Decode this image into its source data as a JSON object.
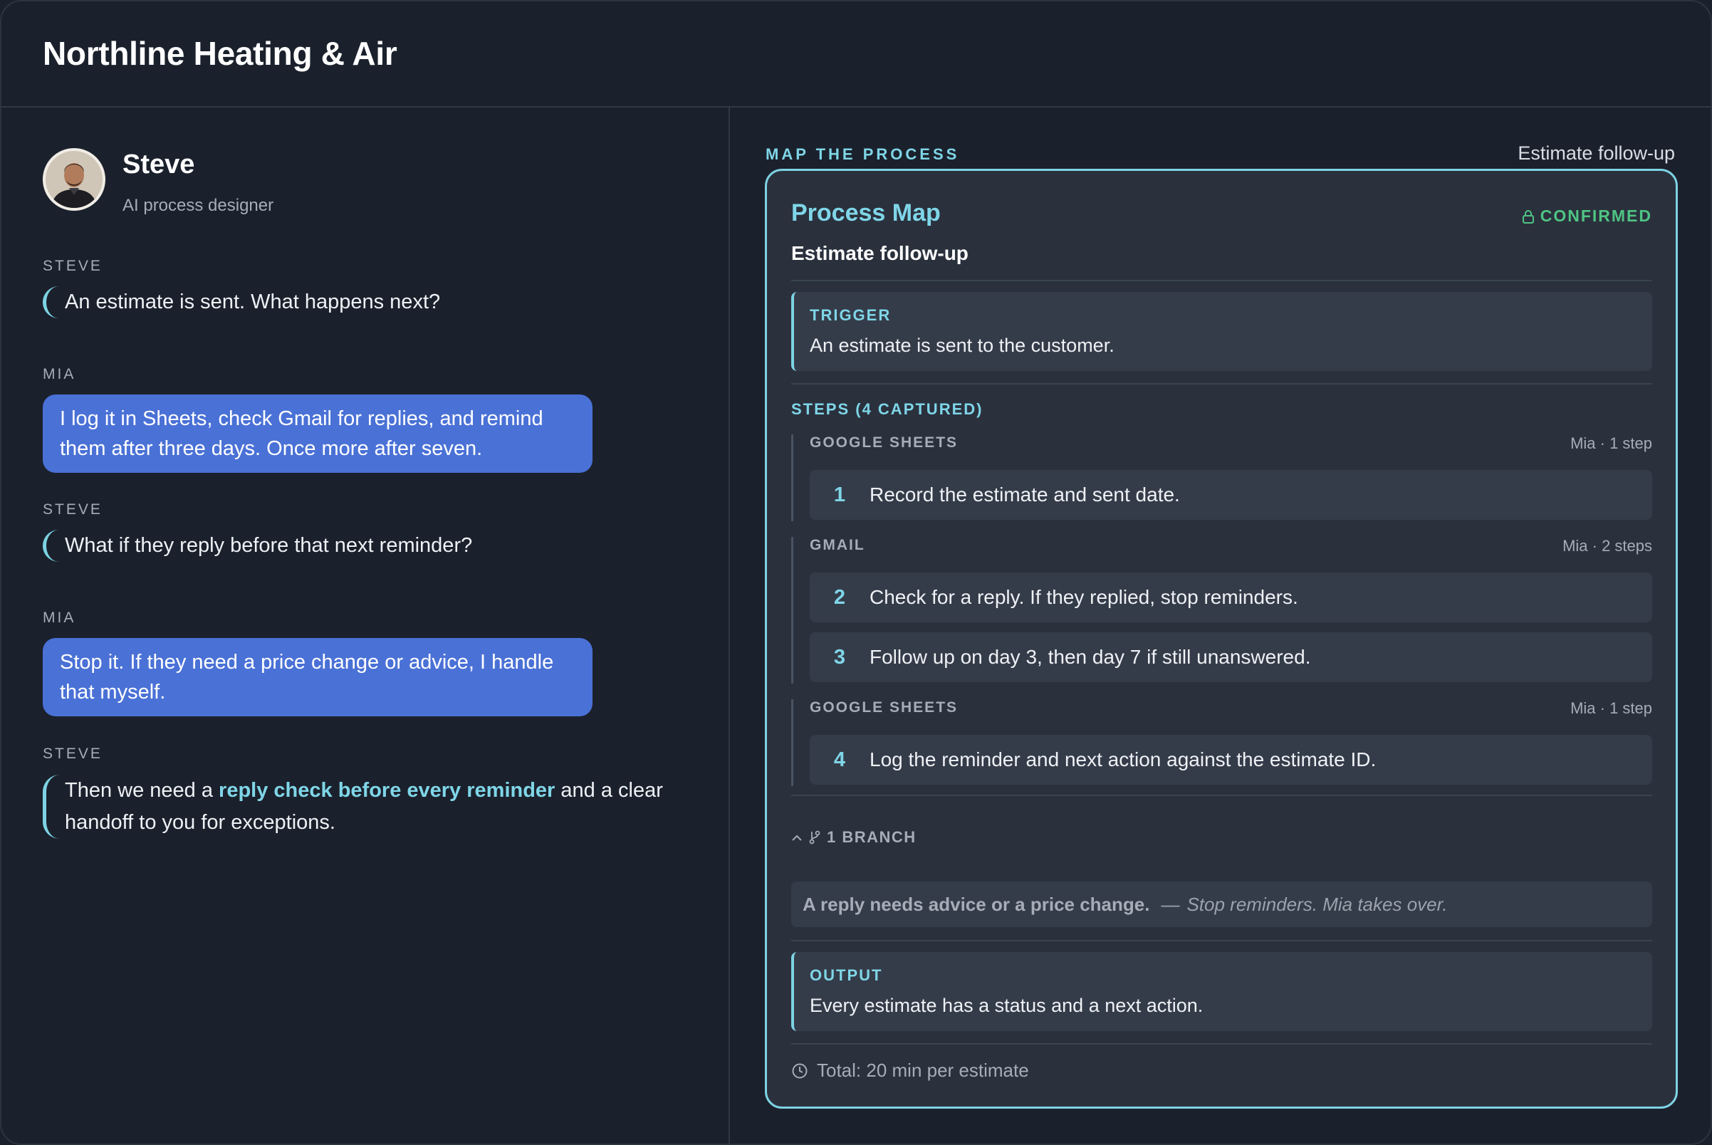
{
  "header": {
    "title": "Northline Heating & Air"
  },
  "agent": {
    "name": "Steve",
    "role": "AI process designer"
  },
  "conversation": [
    {
      "speaker": "STEVE",
      "text": "An estimate is sent. What happens next?"
    },
    {
      "speaker": "MIA",
      "text": "I log it in Sheets, check Gmail for replies, and remind them after three days. Once more after seven."
    },
    {
      "speaker": "STEVE",
      "text": "What if they reply before that next reminder?"
    },
    {
      "speaker": "MIA",
      "text": "Stop it. If they need a price change or advice, I handle that myself."
    },
    {
      "speaker": "STEVE",
      "text_before": "Then we need a ",
      "highlight": "reply check before every reminder",
      "text_after": " and a clear handoff to you for exceptions."
    }
  ],
  "process": {
    "section_label": "MAP THE PROCESS",
    "process_name": "Estimate follow-up",
    "card_title": "Process Map",
    "status": "CONFIRMED",
    "subtitle": "Estimate follow-up",
    "trigger": {
      "label": "TRIGGER",
      "text": "An estimate is sent to the customer."
    },
    "steps_heading": "STEPS (4 CAPTURED)",
    "groups": [
      {
        "name": "GOOGLE SHEETS",
        "meta": "Mia · 1 step",
        "steps": [
          {
            "num": "1",
            "text": "Record the estimate and sent date."
          }
        ]
      },
      {
        "name": "GMAIL",
        "meta": "Mia · 2 steps",
        "steps": [
          {
            "num": "2",
            "text": "Check for a reply. If they replied, stop reminders."
          },
          {
            "num": "3",
            "text": "Follow up on day 3, then day 7 if still unanswered."
          }
        ]
      },
      {
        "name": "GOOGLE SHEETS",
        "meta": "Mia · 1 step",
        "steps": [
          {
            "num": "4",
            "text": "Log the reminder and next action against the estimate ID."
          }
        ]
      }
    ],
    "branch_heading": "1 BRANCH",
    "branch": {
      "condition": "A reply needs advice or a price change.",
      "separator": "—",
      "action": "Stop reminders. Mia takes over."
    },
    "output": {
      "label": "OUTPUT",
      "text": "Every estimate has a status and a next action."
    },
    "total": "Total: 20 min per estimate"
  },
  "icons": {
    "lock": "lock-icon",
    "branch": "branch-icon",
    "chevron": "chevron-up-icon",
    "clock": "clock-icon"
  },
  "colors": {
    "accent": "#7dd3e3",
    "bubble": "#4a71d6",
    "confirmed": "#4fc483",
    "background": "#1b212c"
  }
}
